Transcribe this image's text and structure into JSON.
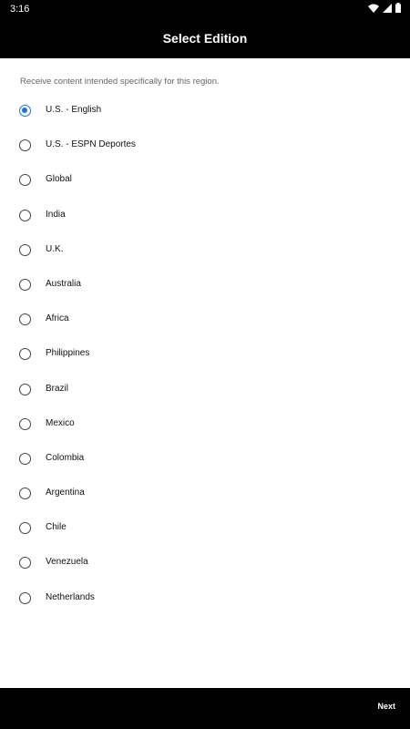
{
  "status_bar": {
    "time": "3:16",
    "icons": [
      "wifi-icon",
      "signal-icon",
      "battery-icon"
    ]
  },
  "header": {
    "title": "Select Edition"
  },
  "description": "Receive content intended specifically for this region.",
  "editions": [
    {
      "label": "U.S. - English",
      "selected": true
    },
    {
      "label": "U.S. - ESPN Deportes",
      "selected": false
    },
    {
      "label": "Global",
      "selected": false
    },
    {
      "label": "India",
      "selected": false
    },
    {
      "label": "U.K.",
      "selected": false
    },
    {
      "label": "Australia",
      "selected": false
    },
    {
      "label": "Africa",
      "selected": false
    },
    {
      "label": "Philippines",
      "selected": false
    },
    {
      "label": "Brazil",
      "selected": false
    },
    {
      "label": "Mexico",
      "selected": false
    },
    {
      "label": "Colombia",
      "selected": false
    },
    {
      "label": "Argentina",
      "selected": false
    },
    {
      "label": "Chile",
      "selected": false
    },
    {
      "label": "Venezuela",
      "selected": false
    },
    {
      "label": "Netherlands",
      "selected": false
    }
  ],
  "footer": {
    "next_label": "Next"
  },
  "colors": {
    "accent": "#1a73e8",
    "bar": "#000000"
  }
}
